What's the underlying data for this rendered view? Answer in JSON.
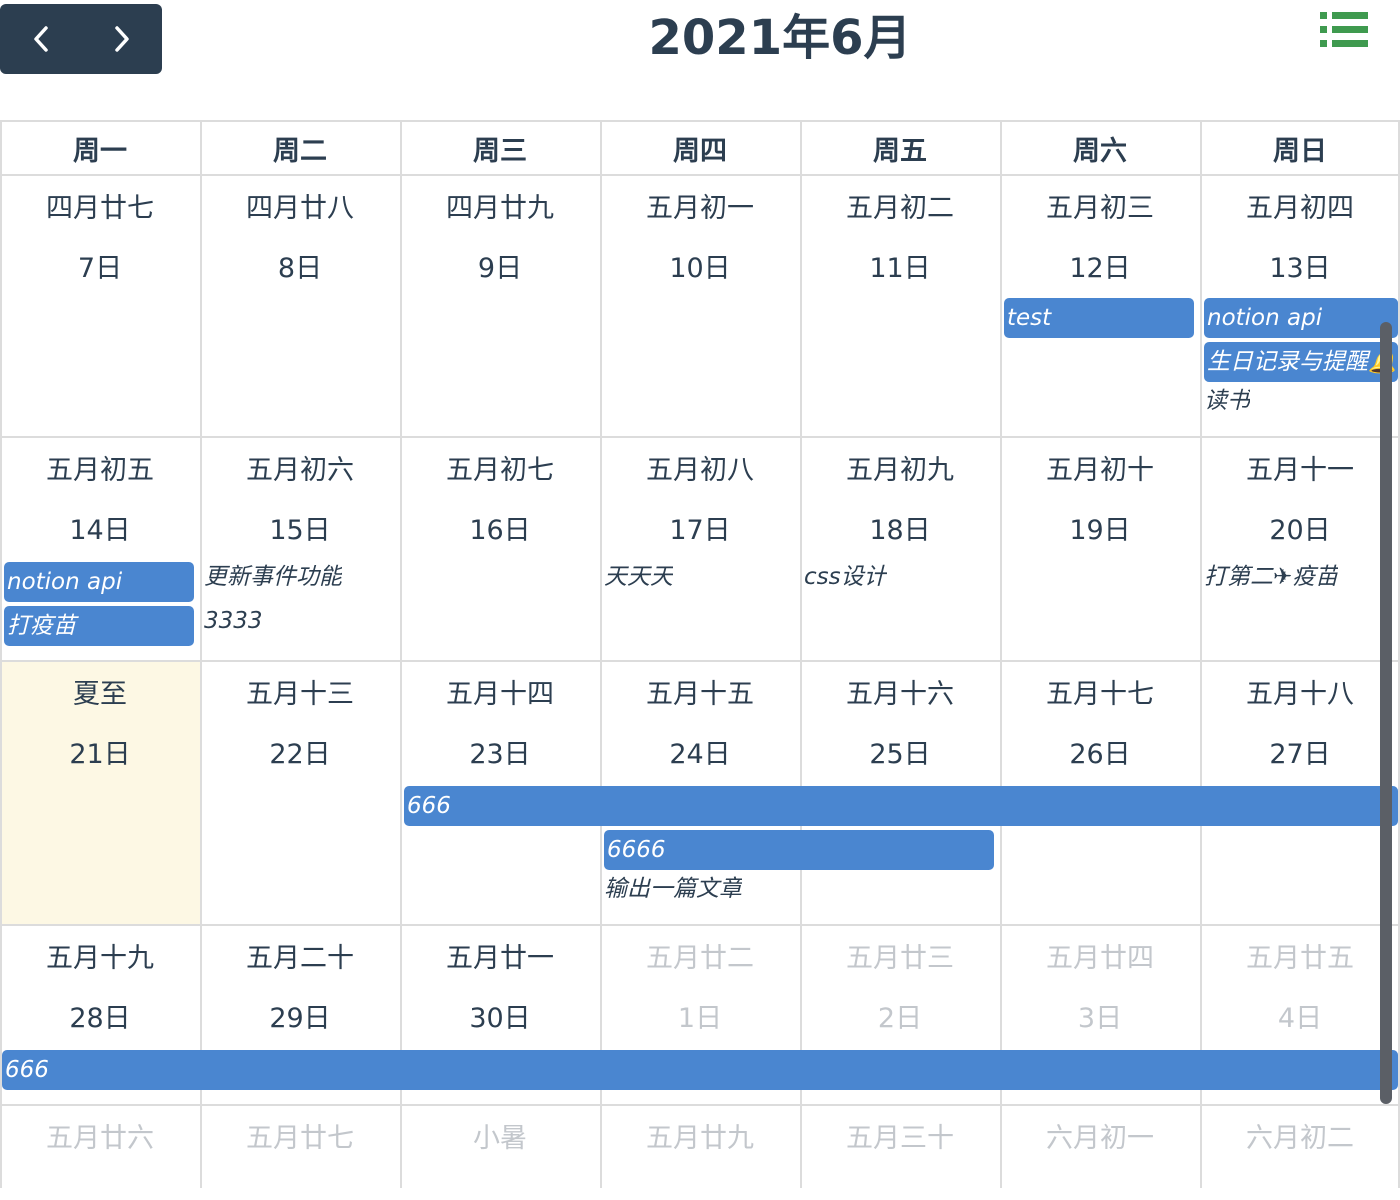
{
  "header": {
    "title": "2021年6月",
    "prev_icon": "chevron-left-icon",
    "next_icon": "chevron-right-icon",
    "list_icon": "list-icon",
    "nav_color": "#2c3e50",
    "list_icon_color": "#3f9a4f"
  },
  "weekdays": [
    "周一",
    "周二",
    "周三",
    "周四",
    "周五",
    "周六",
    "周日"
  ],
  "weeks": [
    {
      "days": [
        {
          "lunar": "四月廿七",
          "solar": "7日"
        },
        {
          "lunar": "四月廿八",
          "solar": "8日"
        },
        {
          "lunar": "四月廿九",
          "solar": "9日"
        },
        {
          "lunar": "五月初一",
          "solar": "10日"
        },
        {
          "lunar": "五月初二",
          "solar": "11日"
        },
        {
          "lunar": "五月初三",
          "solar": "12日"
        },
        {
          "lunar": "五月初四",
          "solar": "13日"
        }
      ]
    },
    {
      "days": [
        {
          "lunar": "五月初五",
          "solar": "14日"
        },
        {
          "lunar": "五月初六",
          "solar": "15日"
        },
        {
          "lunar": "五月初七",
          "solar": "16日"
        },
        {
          "lunar": "五月初八",
          "solar": "17日"
        },
        {
          "lunar": "五月初九",
          "solar": "18日"
        },
        {
          "lunar": "五月初十",
          "solar": "19日"
        },
        {
          "lunar": "五月十一",
          "solar": "20日"
        }
      ]
    },
    {
      "days": [
        {
          "lunar": "夏至",
          "solar": "21日",
          "highlighted": true
        },
        {
          "lunar": "五月十三",
          "solar": "22日"
        },
        {
          "lunar": "五月十四",
          "solar": "23日"
        },
        {
          "lunar": "五月十五",
          "solar": "24日"
        },
        {
          "lunar": "五月十六",
          "solar": "25日"
        },
        {
          "lunar": "五月十七",
          "solar": "26日"
        },
        {
          "lunar": "五月十八",
          "solar": "27日"
        }
      ]
    },
    {
      "days": [
        {
          "lunar": "五月十九",
          "solar": "28日"
        },
        {
          "lunar": "五月二十",
          "solar": "29日"
        },
        {
          "lunar": "五月廿一",
          "solar": "30日"
        },
        {
          "lunar": "五月廿二",
          "solar": "1日",
          "other_month": true
        },
        {
          "lunar": "五月廿三",
          "solar": "2日",
          "other_month": true
        },
        {
          "lunar": "五月廿四",
          "solar": "3日",
          "other_month": true
        },
        {
          "lunar": "五月廿五",
          "solar": "4日",
          "other_month": true
        }
      ]
    },
    {
      "days": [
        {
          "lunar": "五月廿六",
          "other_month": true
        },
        {
          "lunar": "五月廿七",
          "other_month": true
        },
        {
          "lunar": "小暑",
          "other_month": true
        },
        {
          "lunar": "五月廿九",
          "other_month": true
        },
        {
          "lunar": "五月三十",
          "other_month": true
        },
        {
          "lunar": "六月初一",
          "other_month": true
        },
        {
          "lunar": "六月初二",
          "other_month": true
        }
      ]
    }
  ],
  "events": [
    {
      "label": "test",
      "week": 0,
      "col": 5,
      "span": 1,
      "bar": true
    },
    {
      "label": "notion api",
      "week": 0,
      "col": 6,
      "span": 1,
      "bar": true
    },
    {
      "label": "生日记录与提醒🔔",
      "week": 0,
      "col": 6,
      "span": 1,
      "bar": true
    },
    {
      "label": "读书",
      "week": 0,
      "col": 6,
      "span": 1,
      "bar": false
    },
    {
      "label": "notion api",
      "week": 1,
      "col": 0,
      "span": 1,
      "bar": true
    },
    {
      "label": "打疫苗",
      "week": 1,
      "col": 0,
      "span": 1,
      "bar": true
    },
    {
      "label": "更新事件功能",
      "week": 1,
      "col": 1,
      "span": 1,
      "bar": false
    },
    {
      "label": "3333",
      "week": 1,
      "col": 1,
      "span": 1,
      "bar": false
    },
    {
      "label": "天天天",
      "week": 1,
      "col": 3,
      "span": 1,
      "bar": false
    },
    {
      "label": "css设计",
      "week": 1,
      "col": 4,
      "span": 1,
      "bar": false
    },
    {
      "label": "打第二✈疫苗",
      "week": 1,
      "col": 6,
      "span": 1,
      "bar": false
    },
    {
      "label": "666",
      "week": 2,
      "col": 2,
      "span": 5,
      "bar": true
    },
    {
      "label": "6666",
      "week": 2,
      "col": 3,
      "span": 2,
      "bar": true
    },
    {
      "label": "输出一篇文章",
      "week": 2,
      "col": 3,
      "span": 1,
      "bar": false
    },
    {
      "label": "666",
      "week": 3,
      "col": 0,
      "span": 7,
      "bar": true
    }
  ],
  "colors": {
    "event_bar": "#4a86d0",
    "highlight_day": "#fdf8e4",
    "dim_text": "#c3c7cc",
    "grid_line": "#dcdcdc"
  }
}
